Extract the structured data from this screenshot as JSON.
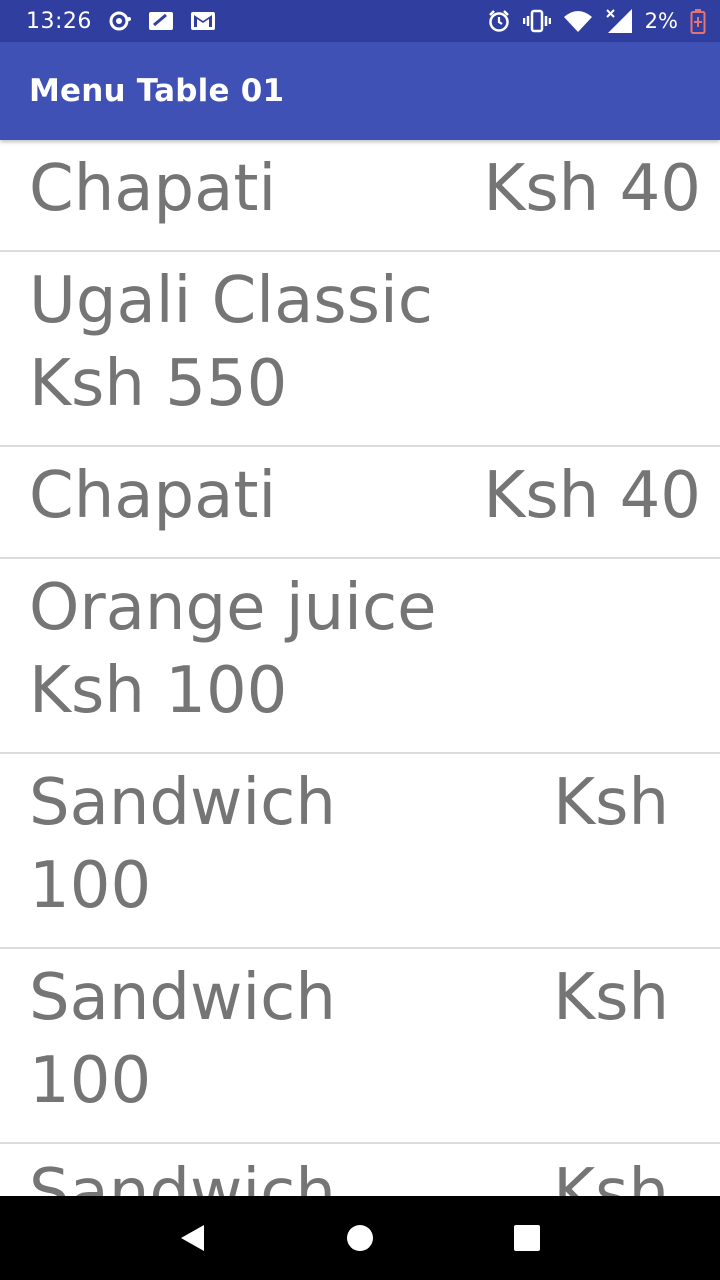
{
  "status_bar": {
    "time": "13:26",
    "battery": "2%",
    "icons": [
      "notification-icon",
      "screen-icon",
      "gmail-icon",
      "alarm-icon",
      "vibrate-icon",
      "wifi-icon",
      "signal-icon",
      "battery-icon"
    ]
  },
  "app_bar": {
    "title": "Menu Table 01"
  },
  "menu": {
    "items": [
      {
        "name": "Chapati",
        "price": "Ksh 40"
      },
      {
        "name": "Ugali Classic",
        "price": "Ksh 550"
      },
      {
        "name": "Chapati",
        "price": "Ksh 40"
      },
      {
        "name": "Orange juice",
        "price": "Ksh 100"
      },
      {
        "name": "Sandwich",
        "price_prefix": "Ksh",
        "price_value": "100"
      },
      {
        "name": "Sandwich",
        "price_prefix": "Ksh",
        "price_value": "100"
      },
      {
        "name": "Sandwich",
        "price_prefix": "Ksh"
      }
    ]
  },
  "colors": {
    "status_bar": "#303f9f",
    "app_bar": "#3f51b5",
    "item_text": "#757575",
    "divider": "#dcdcdc",
    "battery_low": "#e57373"
  }
}
